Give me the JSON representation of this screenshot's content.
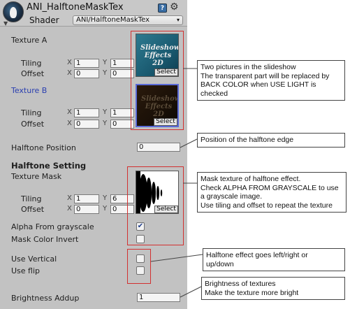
{
  "header": {
    "title": "ANI_HalftoneMaskTex",
    "shader_label": "Shader",
    "shader_value": "ANI/HalftoneMaskTex",
    "help_icon_glyph": "?",
    "gear_icon_glyph": "⚙",
    "fold_icon_glyph": "▼",
    "dropdown_arrow": "▾"
  },
  "texture_a": {
    "label": "Texture A",
    "tiling_label": "Tiling",
    "offset_label": "Offset",
    "tiling_x": "1",
    "tiling_y": "1",
    "offset_x": "0",
    "offset_y": "0",
    "thumb_text": "Slideshow Effects 2D",
    "select_label": "Select"
  },
  "texture_b": {
    "label": "Texture B",
    "tiling_label": "Tiling",
    "offset_label": "Offset",
    "tiling_x": "1",
    "tiling_y": "1",
    "offset_x": "0",
    "offset_y": "0",
    "thumb_text": "Slideshow Effects 2D",
    "select_label": "Select"
  },
  "halftone_position": {
    "label": "Halftone Position",
    "value": "0"
  },
  "halftone_setting": {
    "heading": "Halftone Setting",
    "texture_mask_label": "Texture Mask",
    "tiling_label": "Tiling",
    "offset_label": "Offset",
    "tiling_x": "1",
    "tiling_y": "6",
    "offset_x": "0",
    "offset_y": "0",
    "select_label": "Select"
  },
  "toggles": {
    "alpha_from_grayscale": {
      "label": "Alpha From grayscale",
      "checked": true
    },
    "mask_color_invert": {
      "label": "Mask Color Invert",
      "checked": false
    },
    "use_vertical": {
      "label": "Use Vertical",
      "checked": false
    },
    "use_flip": {
      "label": "Use flip",
      "checked": false
    }
  },
  "brightness_addup": {
    "label": "Brightness Addup",
    "value": "1"
  },
  "axis_labels": {
    "x": "X",
    "y": "Y"
  },
  "check_glyph": "✔",
  "callouts": {
    "slideshow": [
      "Two pictures in the slideshow",
      "The transparent part will be replaced by",
      "BACK COLOR when USE LIGHT is",
      "checked"
    ],
    "halftone_edge": [
      "Position of the halftone edge"
    ],
    "mask": [
      "Mask texture of halftone effect.",
      "Check ALPHA FROM GRAYSCALE to use",
      "a grayscale image.",
      "Use tiling and offset to repeat the texture"
    ],
    "direction": [
      "Halftone effect goes left/right or",
      "up/down"
    ],
    "brightness": [
      "Brightness of textures",
      "Make the texture more bright"
    ]
  },
  "colors": {
    "panel_bg": "#c2c2c2",
    "highlight_red": "#d23030",
    "texture_b_label_blue": "#2a3fb0"
  }
}
